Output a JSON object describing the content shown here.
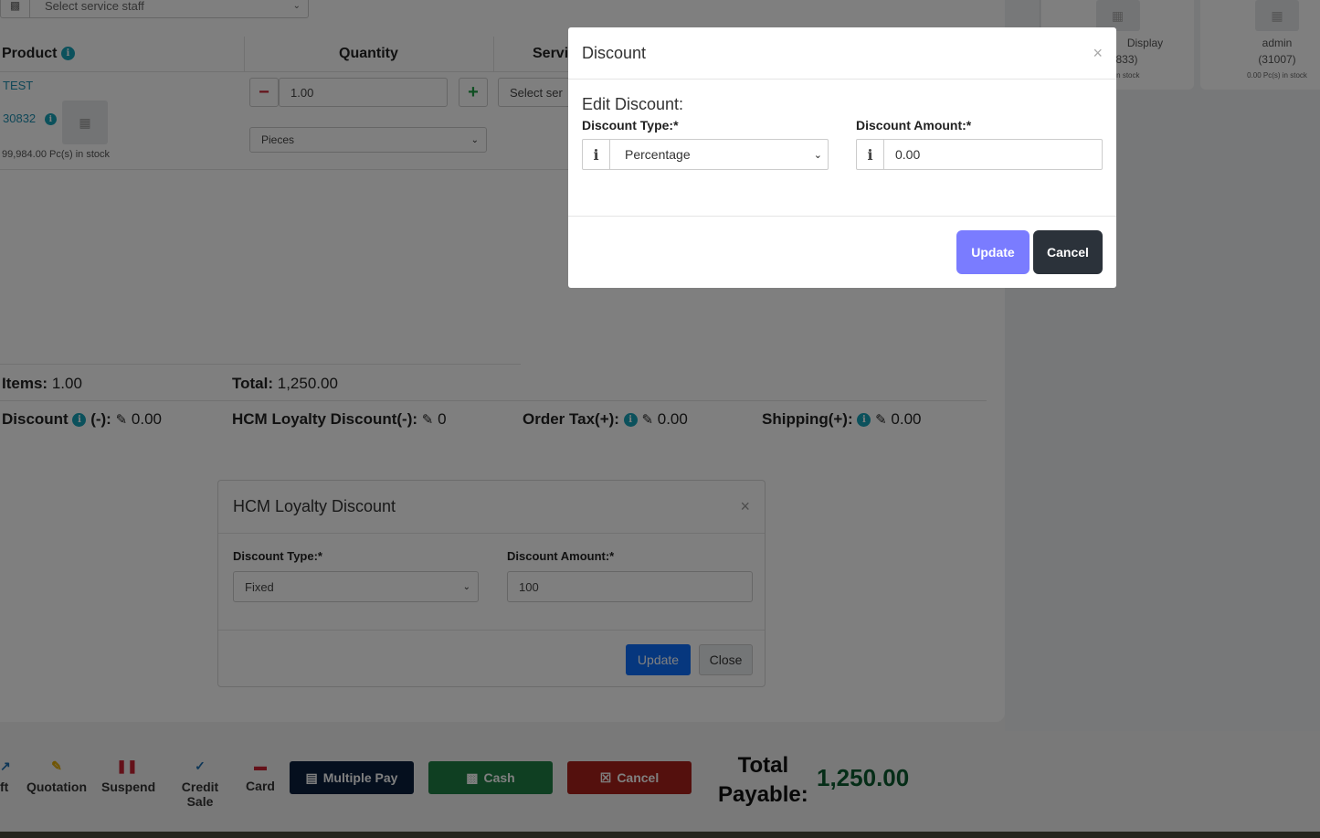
{
  "background": {
    "staff_select_placeholder": "Select service staff",
    "headers": {
      "product": "Product",
      "quantity": "Quantity",
      "service": "Servi"
    },
    "product": {
      "name": "TEST",
      "code": "30832",
      "stock": "99,984.00 Pc(s) in stock"
    },
    "quantity": {
      "value": "1.00",
      "unit": "Pieces",
      "minus": "−",
      "plus": "+"
    },
    "service_select": "Select ser",
    "cards": [
      {
        "name": "Display",
        "code": "833)",
        "stock": "Pc(s) in stock"
      },
      {
        "name": "admin",
        "code": "(31007)",
        "stock": "0.00 Pc(s) in stock"
      }
    ],
    "totals": {
      "items_label": "Items:",
      "items_value": "1.00",
      "total_label": "Total:",
      "total_value": "1,250.00",
      "discount_label": "Discount",
      "discount_sign": "(-):",
      "discount_value": "0.00",
      "hcm_label": "HCM Loyalty Discount(-):",
      "hcm_value": "0",
      "tax_label": "Order Tax(+):",
      "tax_value": "0.00",
      "shipping_label": "Shipping(+):",
      "shipping_value": "0.00"
    }
  },
  "hcm_modal": {
    "title": "HCM Loyalty Discount",
    "type_label": "Discount Type:*",
    "type_value": "Fixed",
    "amount_label": "Discount Amount:*",
    "amount_value": "100",
    "update": "Update",
    "close": "Close"
  },
  "bottom_bar": {
    "actions": [
      {
        "label": "ft",
        "color": "#1f6fb0"
      },
      {
        "label": "Quotation",
        "color": "#e0a800"
      },
      {
        "label": "Suspend",
        "color": "#c82333"
      },
      {
        "label": "Credit Sale",
        "color": "#1f6fb0"
      },
      {
        "label": "Card",
        "color": "#c82333"
      }
    ],
    "multiple_pay": "Multiple Pay",
    "cash": "Cash",
    "cancel": "Cancel",
    "total_payable_label_1": "Total",
    "total_payable_label_2": "Payable:",
    "total_payable_value": "1,250.00",
    "colors": {
      "multiple_pay": "#0a1f3d",
      "cash": "#1e7e45",
      "cancel": "#a8201a"
    }
  },
  "discount_modal": {
    "title": "Discount",
    "close_symbol": "×",
    "subtitle": "Edit Discount:",
    "type_label": "Discount Type:*",
    "type_value": "Percentage",
    "amount_label": "Discount Amount:*",
    "amount_value": "0.00",
    "update": "Update",
    "cancel": "Cancel",
    "colors": {
      "update": "#7a7cff",
      "cancel": "#2b323a"
    }
  }
}
